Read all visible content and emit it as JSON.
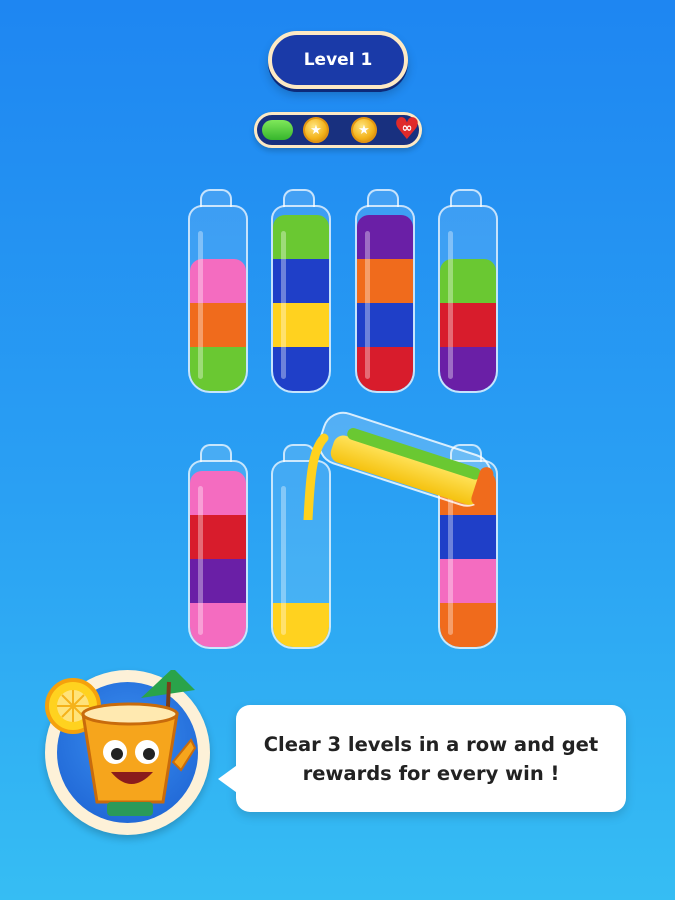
{
  "header": {
    "level_label": "Level 1"
  },
  "progress": {
    "fill_fraction": 0.2,
    "fill_color": "#36b52c",
    "rewards": [
      {
        "icon": "coin-icon"
      },
      {
        "icon": "coin-icon"
      },
      {
        "icon": "infinity-heart-icon",
        "label": "∞"
      }
    ]
  },
  "colors": {
    "pink": "#f46cc0",
    "orange": "#f06b1c",
    "green": "#6ac832",
    "blue": "#1f3fc8",
    "yellow": "#ffd21f",
    "red": "#d81c2c",
    "purple": "#6a1fa6"
  },
  "tubes": [
    {
      "id": "tube-1",
      "layers": [
        "green",
        "orange",
        "pink"
      ]
    },
    {
      "id": "tube-2",
      "layers": [
        "blue",
        "yellow",
        "blue",
        "green"
      ]
    },
    {
      "id": "tube-3",
      "layers": [
        "red",
        "blue",
        "orange",
        "purple"
      ]
    },
    {
      "id": "tube-4",
      "layers": [
        "purple",
        "red",
        "green"
      ]
    },
    {
      "id": "tube-5",
      "layers": [
        "pink",
        "purple",
        "red",
        "pink"
      ]
    },
    {
      "id": "tube-6",
      "layers": [
        "yellow"
      ]
    },
    {
      "id": "tube-7",
      "layers": [
        "orange",
        "pink",
        "blue",
        "orange"
      ]
    }
  ],
  "pouring_tube": {
    "layers": [
      "green",
      "yellow"
    ],
    "stream_color": "yellow"
  },
  "mascot": {
    "icon": "lemonade-cup-mascot-icon"
  },
  "tip": {
    "message": "Clear 3 levels in a row and get rewards for every win !"
  }
}
